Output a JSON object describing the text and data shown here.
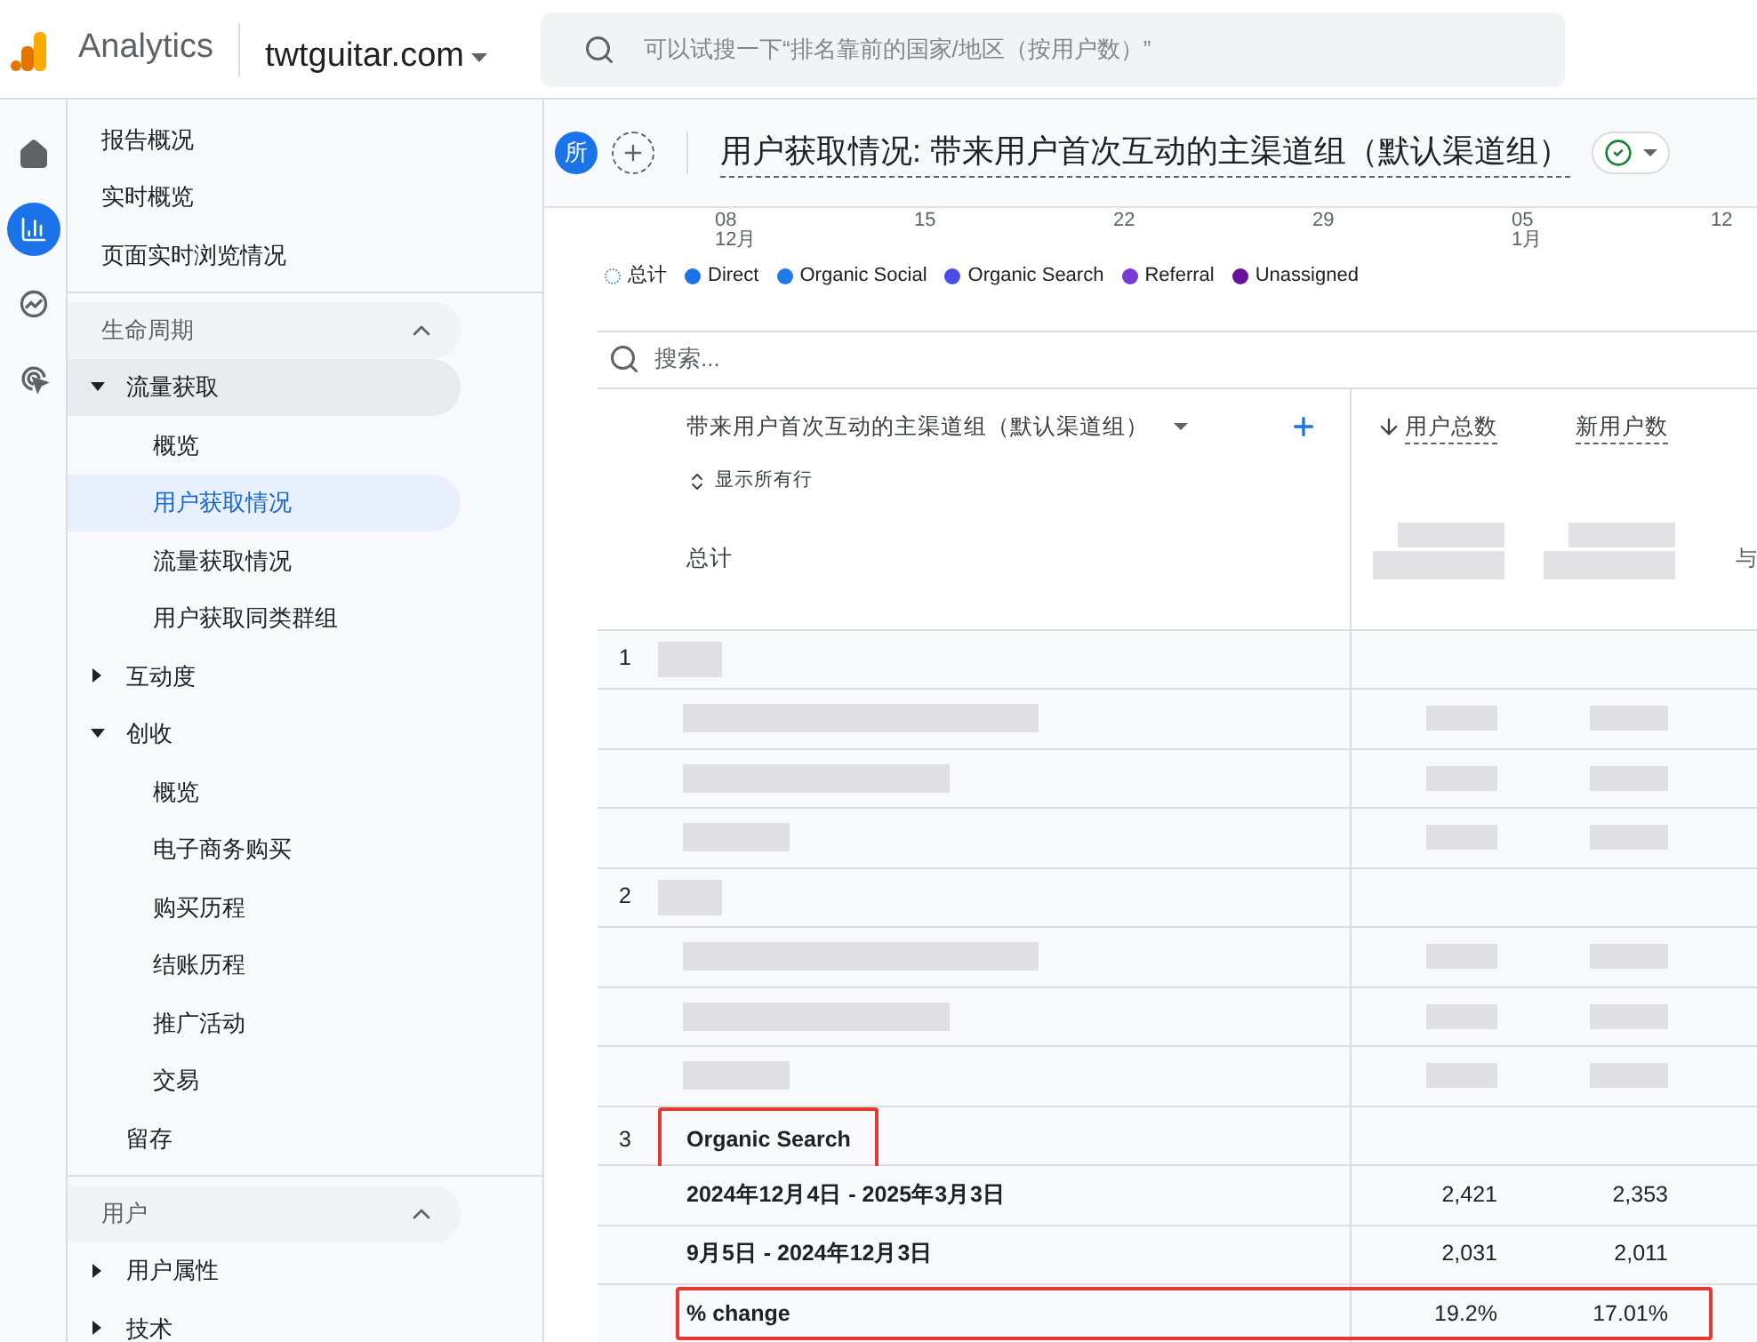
{
  "topbar": {
    "product": "Analytics",
    "property": "twtguitar.com",
    "search_placeholder": "可以试搜一下“排名靠前的国家/地区（按用户数）”"
  },
  "rail": [
    {
      "kind": "home",
      "selected": false
    },
    {
      "kind": "reports",
      "selected": true
    },
    {
      "kind": "explore",
      "selected": false
    },
    {
      "kind": "advertising",
      "selected": false
    }
  ],
  "nav": {
    "top_items": [
      {
        "label": "报告概况",
        "selected": false
      },
      {
        "label": "实时概览",
        "selected": false
      },
      {
        "label": "页面实时浏览情况",
        "selected": false
      }
    ],
    "sections": [
      {
        "label": "生命周期",
        "expanded": true,
        "items": [
          {
            "label": "流量获取",
            "expanded": true,
            "selected": false,
            "children": [
              {
                "label": "概览",
                "selected": false
              },
              {
                "label": "用户获取情况",
                "selected": true
              },
              {
                "label": "流量获取情况",
                "selected": false
              },
              {
                "label": "用户获取同类群组",
                "selected": false
              }
            ]
          },
          {
            "label": "互动度",
            "expanded": false,
            "selected": false
          },
          {
            "label": "创收",
            "expanded": true,
            "selected": false,
            "children": [
              {
                "label": "概览",
                "selected": false
              },
              {
                "label": "电子商务购买",
                "selected": false
              },
              {
                "label": "购买历程",
                "selected": false
              },
              {
                "label": "结账历程",
                "selected": false
              },
              {
                "label": "推广活动",
                "selected": false
              },
              {
                "label": "交易",
                "selected": false
              }
            ]
          },
          {
            "label": "留存",
            "selected": false
          }
        ]
      },
      {
        "label": "用户",
        "expanded": true,
        "items": [
          {
            "label": "用户属性",
            "expanded": false,
            "selected": false
          },
          {
            "label": "技术",
            "expanded": false,
            "selected": false
          }
        ]
      }
    ]
  },
  "report": {
    "avatar": "所",
    "title": "用户获取情况: 带来用户首次互动的主渠道组（默认渠道组）",
    "axis_labels": [
      {
        "day": "08",
        "month": "12月"
      },
      {
        "day": "15"
      },
      {
        "day": "22"
      },
      {
        "day": "29"
      },
      {
        "day": "05",
        "month": "1月"
      },
      {
        "day": "12"
      }
    ],
    "legend": [
      {
        "label": "总计",
        "kind": "total",
        "color": "#4285f4"
      },
      {
        "label": "Direct",
        "kind": "series",
        "color": "#1a73e8"
      },
      {
        "label": "Organic Social",
        "kind": "series",
        "color": "#1f7ae8"
      },
      {
        "label": "Organic Search",
        "kind": "series",
        "color": "#4a4ee8"
      },
      {
        "label": "Referral",
        "kind": "series",
        "color": "#7a3ad6"
      },
      {
        "label": "Unassigned",
        "kind": "series",
        "color": "#6a0f9c"
      }
    ],
    "search_placeholder": "搜索...",
    "table": {
      "dimension": "带来用户首次互动的主渠道组（默认渠道组）",
      "show_all": "显示所有行",
      "total_label": "总计",
      "columns": [
        {
          "label": "用户总数",
          "sorted": true
        },
        {
          "label": "新用户数",
          "sorted": false
        }
      ],
      "column_3": "与",
      "groups": [
        {
          "number": "1",
          "kind": "redacted"
        },
        {
          "number": "2",
          "kind": "redacted"
        },
        {
          "number": "3",
          "kind": "named",
          "name": "Organic Search",
          "highlighted": true,
          "rows": [
            {
              "label": "2024年12月4日 - 2025年3月3日",
              "values": [
                "2,421",
                "2,353"
              ],
              "highlighted": false
            },
            {
              "label": "9月5日 - 2024年12月3日",
              "values": [
                "2,031",
                "2,011"
              ],
              "highlighted": false
            },
            {
              "label": "% change",
              "values": [
                "19.2%",
                "17.01%"
              ],
              "highlighted": true
            }
          ]
        }
      ]
    }
  }
}
